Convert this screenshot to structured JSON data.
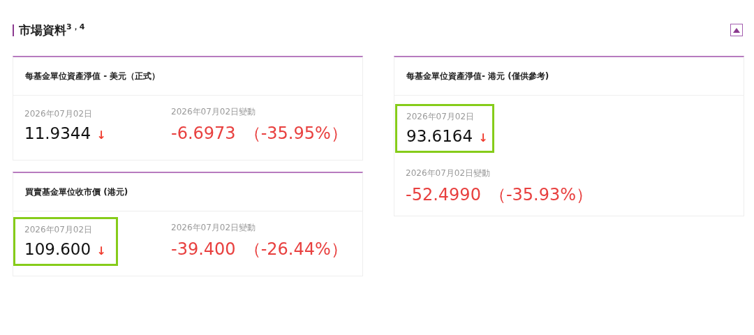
{
  "section": {
    "title": "市場資料$^{3，4}$",
    "collapse_button": {
      "expanded": true
    }
  },
  "cards": [
    {
      "title": "每基金單位資產淨值 - 美元（正式）",
      "kind": "side",
      "price": {
        "date": "2026年07月02日",
        "value": "11.9344",
        "arrow": "↓",
        "highlighted": false
      },
      "change": {
        "date": "2026年07月02日變動",
        "value": "-6.6973",
        "percent": "（-35.95%）"
      }
    },
    {
      "title": "每基金單位資產淨值- 港元 (僅供參考)",
      "kind": "stacked",
      "price": {
        "date": "2026年07月02日",
        "value": "93.6164",
        "arrow": "↓",
        "highlighted": true
      },
      "change": {
        "date": "2026年07月02日變動",
        "value": "-52.4990",
        "percent": "（-35.93%）"
      }
    },
    {
      "title": "買賣基金單位收市價 (港元)",
      "kind": "side",
      "price": {
        "date": "2026年07月02日",
        "value": "109.600",
        "arrow": "↓",
        "highlighted": true
      },
      "change": {
        "date": "2026年07月02日變動",
        "value": "-39.400",
        "percent": "（-26.44%）"
      }
    }
  ]
}
